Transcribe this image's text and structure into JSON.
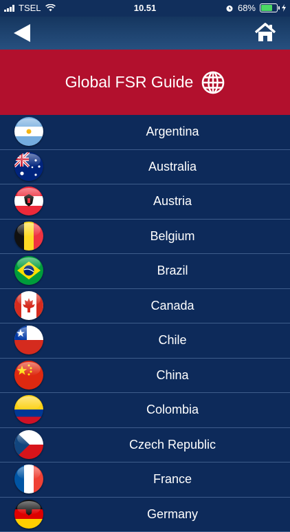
{
  "status_bar": {
    "carrier": "TSEL",
    "time": "10.51",
    "battery": "68%"
  },
  "banner": {
    "title": "Global FSR Guide"
  },
  "countries": [
    {
      "name": "Argentina",
      "flag": "argentina-flag-icon"
    },
    {
      "name": "Australia",
      "flag": "australia-flag-icon"
    },
    {
      "name": "Austria",
      "flag": "austria-flag-icon"
    },
    {
      "name": "Belgium",
      "flag": "belgium-flag-icon"
    },
    {
      "name": "Brazil",
      "flag": "brazil-flag-icon"
    },
    {
      "name": "Canada",
      "flag": "canada-flag-icon"
    },
    {
      "name": "Chile",
      "flag": "chile-flag-icon"
    },
    {
      "name": "China",
      "flag": "china-flag-icon"
    },
    {
      "name": "Colombia",
      "flag": "colombia-flag-icon"
    },
    {
      "name": "Czech Republic",
      "flag": "czech-republic-flag-icon"
    },
    {
      "name": "France",
      "flag": "france-flag-icon"
    },
    {
      "name": "Germany",
      "flag": "germany-flag-icon"
    }
  ],
  "colors": {
    "banner": "#b2102d",
    "list_bg": "#0d2a5a",
    "navbar": "#1f4270"
  }
}
